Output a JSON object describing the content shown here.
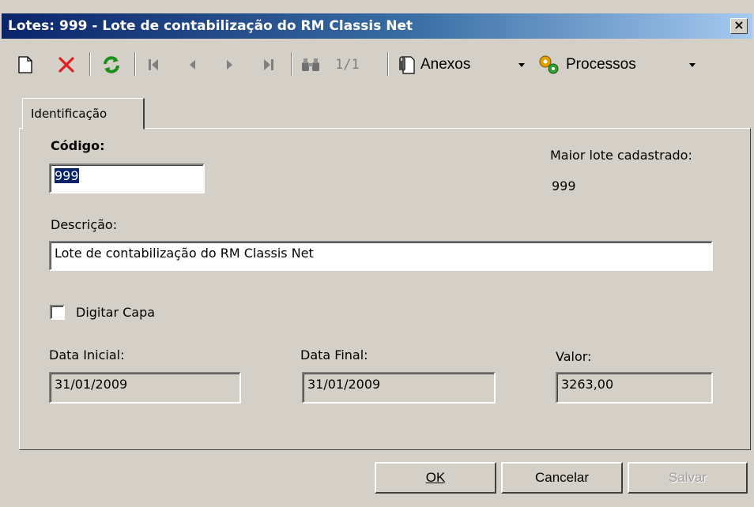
{
  "window": {
    "title": "Lotes: 999 - Lote de contabilização do RM Classis Net",
    "close_label": "×"
  },
  "toolbar": {
    "counter": "1/1",
    "attachments_label": "Anexos",
    "processes_label": "Processos"
  },
  "tabs": [
    {
      "label": "Identificação"
    }
  ],
  "form": {
    "code_label": "Código:",
    "code_value": "999",
    "max_batch_label": "Maior lote cadastrado:",
    "max_batch_value": "999",
    "description_label": "Descrição:",
    "description_value": "Lote de contabilização do RM Classis Net",
    "cover_checkbox_label": "Digitar Capa",
    "start_date_label": "Data Inicial:",
    "start_date_value": "31/01/2009",
    "end_date_label": "Data Final:",
    "end_date_value": "31/01/2009",
    "value_label": "Valor:",
    "value_value": "3263,00"
  },
  "buttons": {
    "ok": "OK",
    "cancel": "Cancelar",
    "save": "Salvar"
  },
  "colors": {
    "titlebar_start": "#0a246a",
    "titlebar_end": "#a6caf0",
    "dialog_bg": "#d4d0c8",
    "delete_red": "#e02020",
    "refresh_green": "#1a8f1a"
  }
}
